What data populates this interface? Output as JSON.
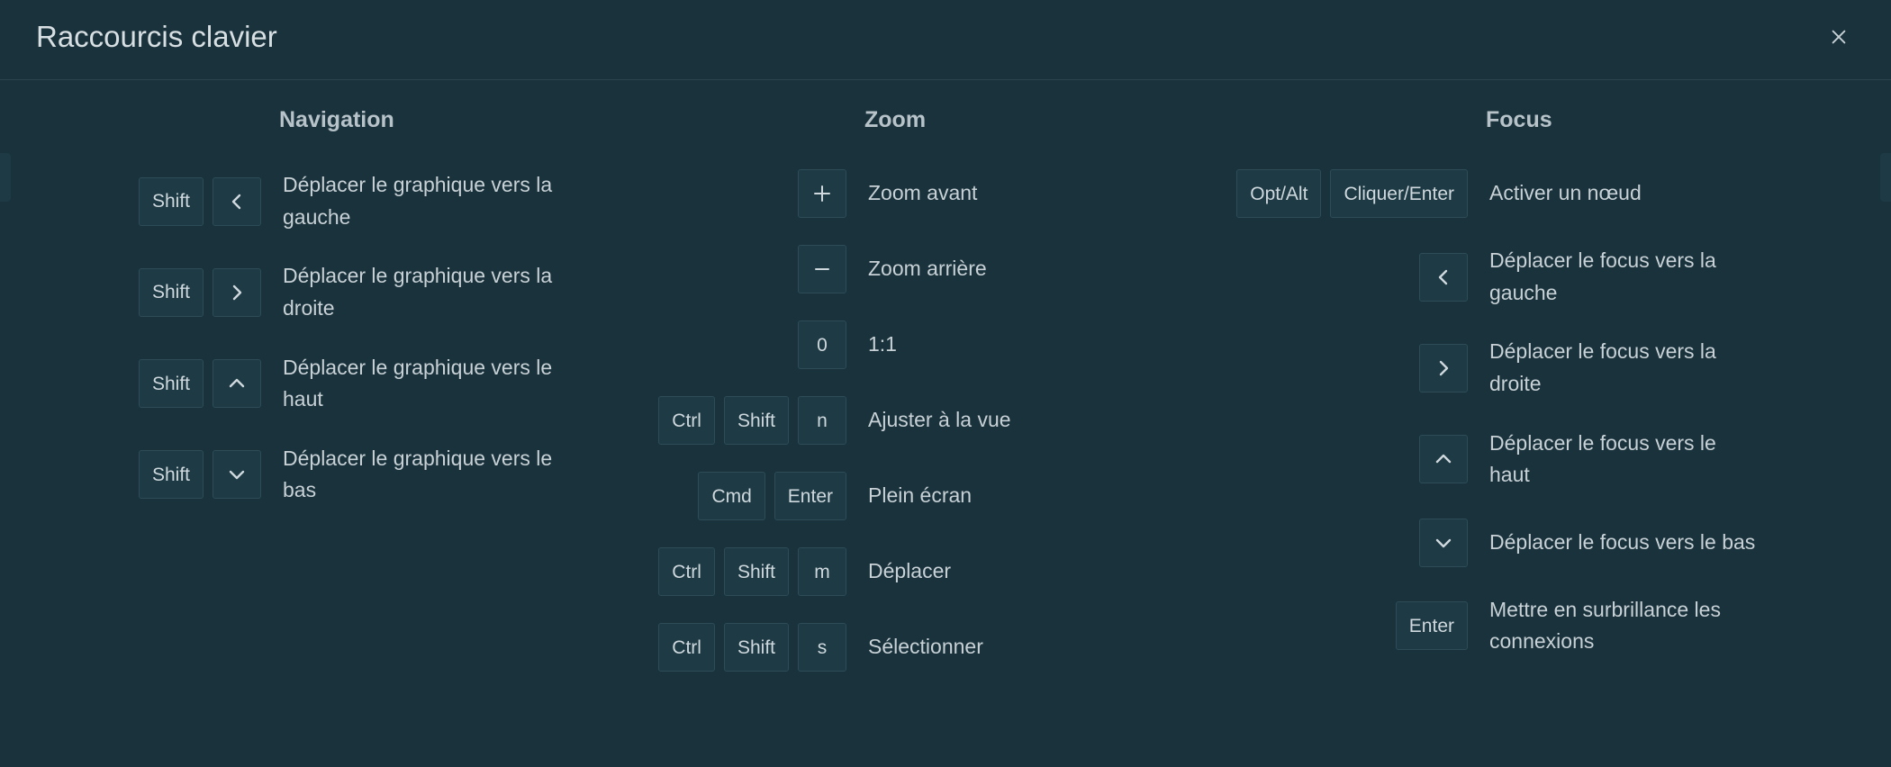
{
  "title": "Raccourcis clavier",
  "keys": {
    "shift": "Shift",
    "ctrl": "Ctrl",
    "cmd": "Cmd",
    "enter": "Enter",
    "optalt": "Opt/Alt",
    "clickenter": "Cliquer/Enter",
    "zero": "0",
    "n": "n",
    "m": "m",
    "s": "s"
  },
  "sections": {
    "navigation": {
      "title": "Navigation",
      "rows": {
        "left": "Déplacer le graphique vers la gauche",
        "right": "Déplacer le graphique vers la droite",
        "up": "Déplacer le graphique vers le haut",
        "down": "Déplacer le graphique vers le bas"
      }
    },
    "zoom": {
      "title": "Zoom",
      "rows": {
        "in": "Zoom avant",
        "out": "Zoom arrière",
        "reset": "1:1",
        "fit": "Ajuster à la vue",
        "fullscreen": "Plein écran",
        "move": "Déplacer",
        "select": "Sélectionner"
      }
    },
    "focus": {
      "title": "Focus",
      "rows": {
        "activate": "Activer un nœud",
        "left": "Déplacer le focus vers la gauche",
        "right": "Déplacer le focus vers la droite",
        "up": "Déplacer le focus vers le haut",
        "down": "Déplacer le focus vers le bas",
        "highlight": "Mettre en surbrillance les connexions"
      }
    }
  }
}
